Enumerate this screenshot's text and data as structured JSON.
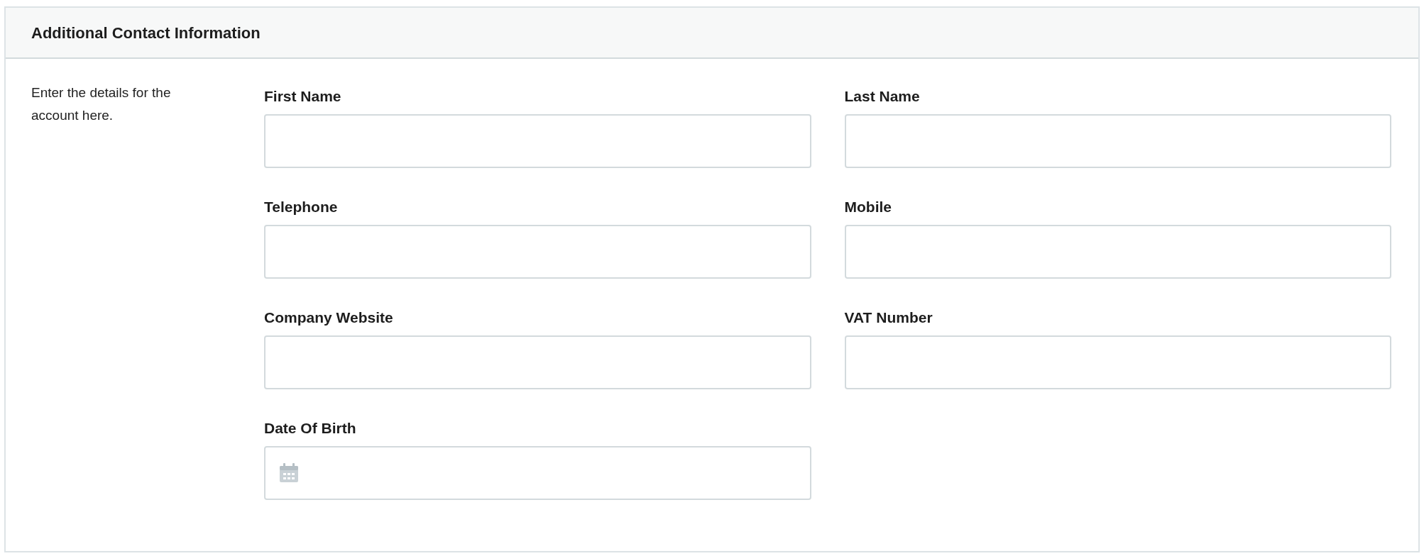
{
  "panel": {
    "title": "Additional Contact Information",
    "description": "Enter the details for the account here."
  },
  "fields": [
    {
      "label": "First Name",
      "kind": "text"
    },
    {
      "label": "Last Name",
      "kind": "text"
    },
    {
      "label": "Telephone",
      "kind": "text"
    },
    {
      "label": "Mobile",
      "kind": "text"
    },
    {
      "label": "Company Website",
      "kind": "text"
    },
    {
      "label": "VAT Number",
      "kind": "text"
    },
    {
      "label": "Date Of Birth",
      "kind": "date"
    }
  ]
}
